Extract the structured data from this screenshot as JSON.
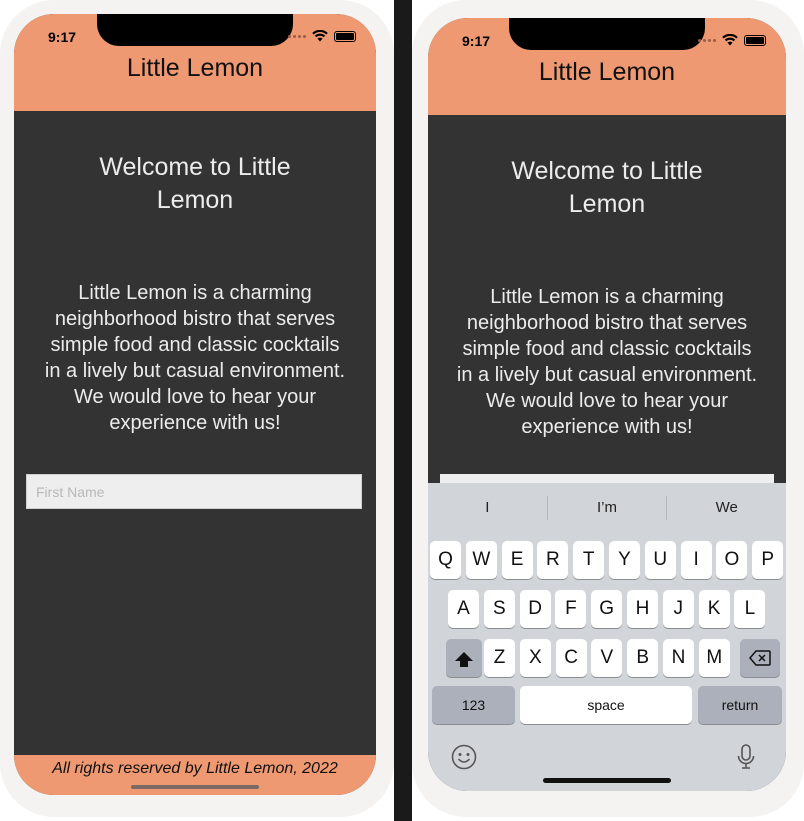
{
  "status": {
    "time": "9:17"
  },
  "header": {
    "title": "Little Lemon"
  },
  "welcome": {
    "heading_line1": "Welcome to Little",
    "heading_line2": "Lemon"
  },
  "description": {
    "lines": [
      "Little Lemon is a charming",
      "neighborhood bistro that serves",
      "simple food and classic cocktails",
      "in a lively but casual environment.",
      "We would love to hear your",
      "experience with us!"
    ]
  },
  "form": {
    "first_name_placeholder": "First Name",
    "first_name_value": ""
  },
  "footer": {
    "text": "All rights reserved by Little Lemon, 2022"
  },
  "keyboard": {
    "suggestions": [
      "I",
      "I’m",
      "We"
    ],
    "row1": [
      "Q",
      "W",
      "E",
      "R",
      "T",
      "Y",
      "U",
      "I",
      "O",
      "P"
    ],
    "row2": [
      "A",
      "S",
      "D",
      "F",
      "G",
      "H",
      "J",
      "K",
      "L"
    ],
    "row3": [
      "Z",
      "X",
      "C",
      "V",
      "B",
      "N",
      "M"
    ],
    "numbers_label": "123",
    "space_label": "space",
    "return_label": "return"
  },
  "colors": {
    "header": "#ee9972",
    "background": "#333333",
    "text": "#ececec",
    "keyboard": "#d1d4d9"
  },
  "icons": [
    "wifi-icon",
    "battery-icon",
    "shift-icon",
    "backspace-icon",
    "emoji-icon",
    "microphone-icon"
  ]
}
